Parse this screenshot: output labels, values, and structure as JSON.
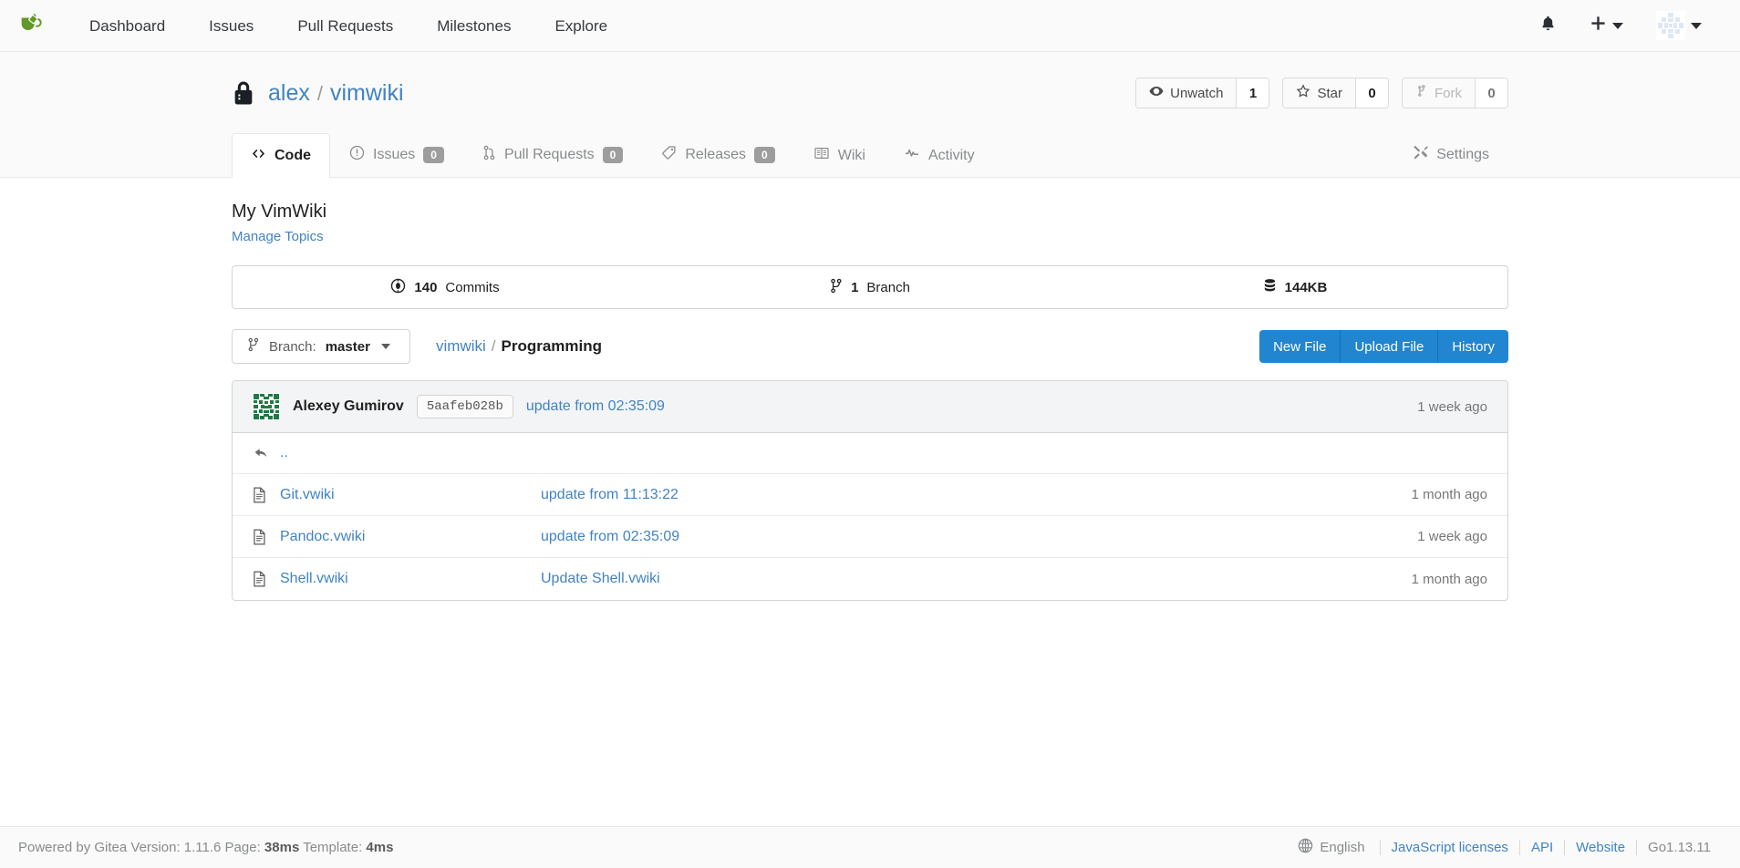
{
  "navbar": {
    "logo_icon": "gitea-teacup-logo",
    "links": [
      {
        "label": "Dashboard",
        "name": "nav-link-dashboard"
      },
      {
        "label": "Issues",
        "name": "nav-link-issues"
      },
      {
        "label": "Pull Requests",
        "name": "nav-link-pull-requests"
      },
      {
        "label": "Milestones",
        "name": "nav-link-milestones"
      },
      {
        "label": "Explore",
        "name": "nav-link-explore"
      }
    ],
    "bell_icon": "notification-bell-icon",
    "plus_icon": "plus-icon",
    "avatar_icon": "user-avatar"
  },
  "repo": {
    "visibility_icon": "lock-icon",
    "owner": "alex",
    "separator": "/",
    "name": "vimwiki",
    "watch": {
      "label": "Unwatch",
      "count": "1",
      "icon": "eye-icon"
    },
    "star": {
      "label": "Star",
      "count": "0",
      "icon": "star-icon"
    },
    "fork": {
      "label": "Fork",
      "count": "0",
      "icon": "fork-icon"
    },
    "tabs": [
      {
        "label": "Code",
        "icon": "code-icon",
        "badge": null,
        "active": true
      },
      {
        "label": "Issues",
        "icon": "issue-opened-icon",
        "badge": "0",
        "active": false
      },
      {
        "label": "Pull Requests",
        "icon": "git-pull-request-icon",
        "badge": "0",
        "active": false
      },
      {
        "label": "Releases",
        "icon": "tag-icon",
        "badge": "0",
        "active": false
      },
      {
        "label": "Wiki",
        "icon": "book-icon",
        "badge": null,
        "active": false
      },
      {
        "label": "Activity",
        "icon": "pulse-icon",
        "badge": null,
        "active": false
      }
    ],
    "settings_tab": {
      "label": "Settings",
      "icon": "tools-icon"
    },
    "description": "My VimWiki",
    "manage_topics": "Manage Topics"
  },
  "stats": [
    {
      "icon": "commit-icon",
      "num": "140",
      "label": "Commits",
      "name": "stat-commits"
    },
    {
      "icon": "branch-icon",
      "num": "1",
      "label": "Branch",
      "name": "stat-branches"
    },
    {
      "icon": "database-icon",
      "num": "144KB",
      "label": "",
      "name": "stat-repo-size"
    }
  ],
  "branch_selector": {
    "prefix": "Branch:",
    "current": "master",
    "icon": "branch-icon"
  },
  "breadcrumb": {
    "root": "vimwiki",
    "separator": "/",
    "current": "Programming"
  },
  "file_actions": [
    {
      "label": "New File",
      "name": "new-file-button"
    },
    {
      "label": "Upload File",
      "name": "upload-file-button"
    },
    {
      "label": "History",
      "name": "history-button"
    }
  ],
  "latest_commit": {
    "avatar": "identicon-avatar",
    "author": "Alexey Gumirov",
    "sha": "5aafeb028b",
    "message": "update from 02:35:09",
    "age": "1 week ago"
  },
  "files": [
    {
      "icon": "reply-arrow-icon",
      "name": "..",
      "message": "",
      "age": "",
      "is_parent": true
    },
    {
      "icon": "file-icon",
      "name": "Git.vwiki",
      "message": "update from 11:13:22",
      "age": "1 month ago",
      "is_parent": false
    },
    {
      "icon": "file-icon",
      "name": "Pandoc.vwiki",
      "message": "update from 02:35:09",
      "age": "1 week ago",
      "is_parent": false
    },
    {
      "icon": "file-icon",
      "name": "Shell.vwiki",
      "message": "Update Shell.vwiki",
      "age": "1 month ago",
      "is_parent": false
    }
  ],
  "footer": {
    "powered_prefix": "Powered by Gitea Version:",
    "version": "1.11.6",
    "page_label": "Page:",
    "page_time": "38ms",
    "template_label": "Template:",
    "template_time": "4ms",
    "language_icon": "globe-icon",
    "language": "English",
    "links": [
      {
        "label": "JavaScript licenses",
        "name": "footer-link-js-licenses"
      },
      {
        "label": "API",
        "name": "footer-link-api"
      },
      {
        "label": "Website",
        "name": "footer-link-website"
      }
    ],
    "go_version": "Go1.13.11"
  },
  "colors": {
    "brand_green": "#609926",
    "link_blue": "#4183c4",
    "button_blue": "#2185d0",
    "muted_grey": "#888b8d"
  }
}
